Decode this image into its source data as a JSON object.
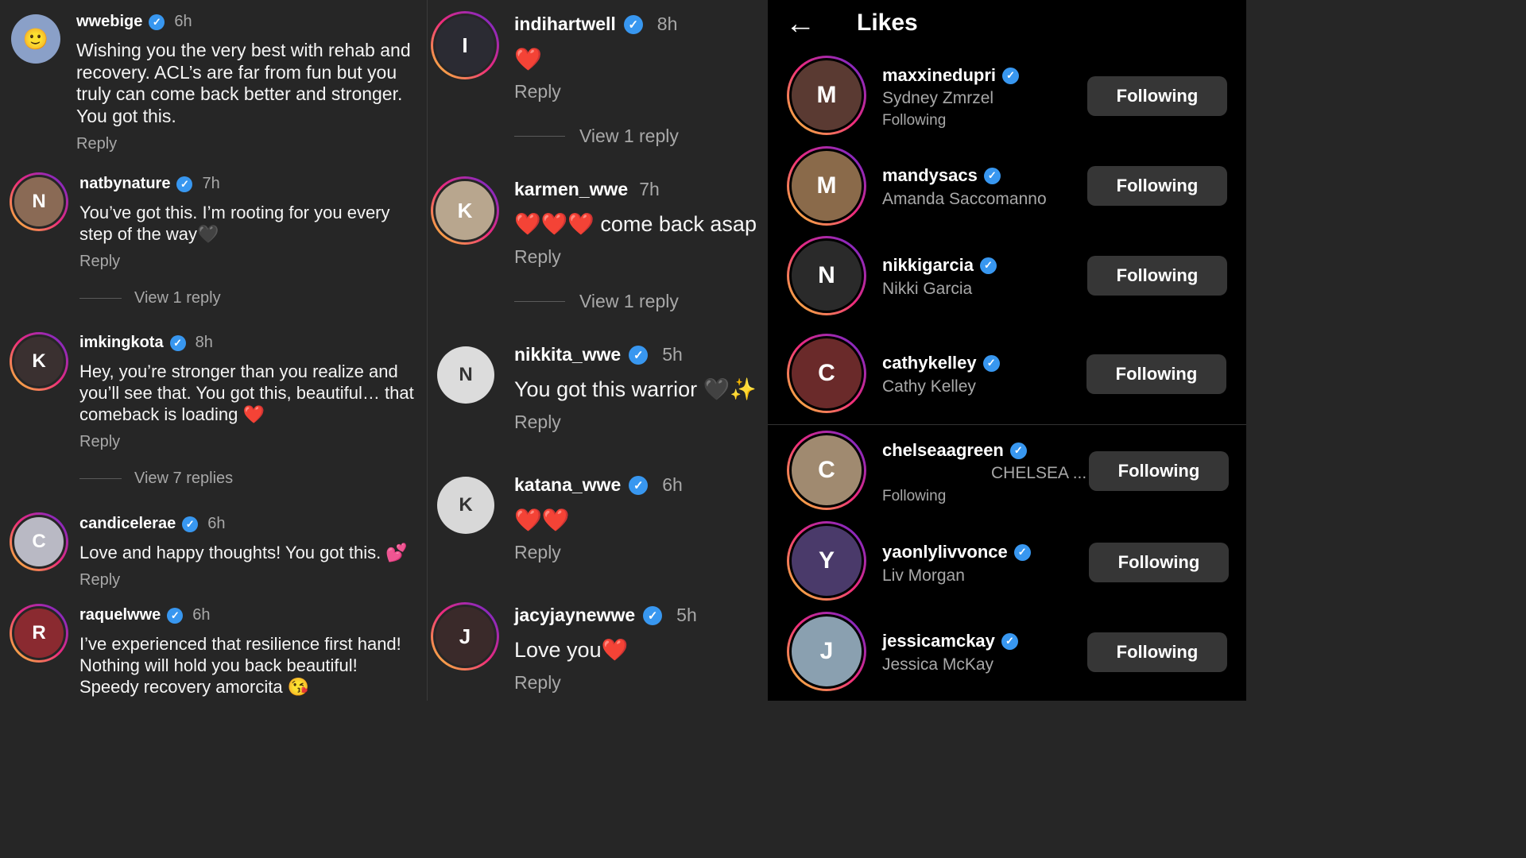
{
  "comments_left": [
    {
      "username": "wwebige",
      "time": "6h",
      "lines": [
        "Wishing you the very best with rehab and",
        "recovery. ACL’s are far from fun but you",
        "truly can come back better and stronger.",
        "You got this."
      ],
      "reply": "Reply"
    },
    {
      "username": "natbynature",
      "time": "7h",
      "lines": [
        "You’ve got this. I’m rooting for you every",
        "step of the way🖤"
      ],
      "reply": "Reply",
      "view_replies": "View 1 reply"
    },
    {
      "username": "imkingkota",
      "time": "8h",
      "lines": [
        "Hey, you’re stronger than you realize and",
        "you’ll see that. You got this, beautiful… that",
        "comeback is loading ❤️"
      ],
      "reply": "Reply",
      "view_replies": "View 7 replies"
    },
    {
      "username": "candicelerae",
      "time": "6h",
      "lines": [
        "Love and happy thoughts! You got this. 💕"
      ],
      "reply": "Reply"
    },
    {
      "username": "raquelwwe",
      "time": "6h",
      "lines": [
        "I’ve experienced that resilience first hand!",
        "Nothing will hold you back beautiful!",
        "Speedy recovery amorcita 😘"
      ]
    }
  ],
  "comments_mid": [
    {
      "username": "indihartwell",
      "time": "8h",
      "text": "❤️",
      "reply": "Reply",
      "view_replies": "View 1 reply"
    },
    {
      "username": "karmen_wwe",
      "time": "7h",
      "text": "❤️❤️❤️ come back asap",
      "reply": "Reply",
      "view_replies": "View 1 reply"
    },
    {
      "username": "nikkita_wwe",
      "time": "5h",
      "text": "You got this warrior 🖤✨",
      "reply": "Reply"
    },
    {
      "username": "katana_wwe",
      "time": "6h",
      "text": "❤️❤️",
      "reply": "Reply"
    },
    {
      "username": "jacyjaynewwe",
      "time": "5h",
      "text": "Love you❤️",
      "reply": "Reply"
    }
  ],
  "likes": {
    "title": "Likes",
    "back_icon": "arrow-left-icon",
    "users": [
      {
        "username": "maxxinedupri",
        "full_name": "Sydney Zmrzel",
        "sub": "Following",
        "button": "Following"
      },
      {
        "username": "mandysacs",
        "full_name": "Amanda Saccomanno",
        "button": "Following"
      },
      {
        "username": "nikkigarcia",
        "full_name": "Nikki Garcia",
        "button": "Following"
      },
      {
        "username": "cathykelley",
        "full_name": "Cathy Kelley",
        "button": "Following"
      },
      {
        "username": "chelseaagreen",
        "full_name": "CHELSEA ...",
        "sub": "Following",
        "button": "Following"
      },
      {
        "username": "yaonlylivvonce",
        "full_name": "Liv Morgan",
        "button": "Following"
      },
      {
        "username": "jessicamckay",
        "full_name": "Jessica McKay",
        "button": "Following"
      }
    ]
  },
  "verified_glyph": "✓",
  "colors": {
    "background": "#262626",
    "likes_background": "#000000",
    "verified": "#3897f0",
    "muted": "#a8a8a8",
    "button": "#363636",
    "heart": "#e0242e"
  }
}
